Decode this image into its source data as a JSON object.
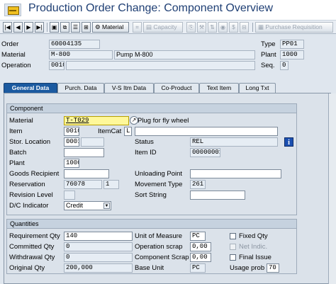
{
  "window": {
    "title": "Production Order Change: Component Overview"
  },
  "toolbar": {
    "material_label": "Material",
    "capacity_label": "Capacity",
    "purchase_requisition_label": "Purchase Requisition"
  },
  "header": {
    "order_label": "Order",
    "order_value": "60004135",
    "type_label": "Type",
    "type_value": "PP01",
    "material_label": "Material",
    "material_value": "M-800",
    "material_desc": "Pump M-800",
    "plant_label": "Plant",
    "plant_value": "1000",
    "operation_label": "Operation",
    "operation_value": "0010",
    "seq_label": "Seq.",
    "seq_value": "0"
  },
  "tabs": [
    "General Data",
    "Purch. Data",
    "V-S Itm Data",
    "Co-Product",
    "Text Item",
    "Long Txt"
  ],
  "component": {
    "heading": "Component",
    "material_label": "Material",
    "material_value": "T-T029",
    "material_desc": "Plug for fly wheel",
    "item_label": "Item",
    "item_value": "0010",
    "itemcat_label": "ItemCat",
    "itemcat_value": "L",
    "stor_location_label": "Stor. Location",
    "stor_location_value": "0001",
    "status_label": "Status",
    "status_value": "REL",
    "batch_label": "Batch",
    "item_id_label": "Item ID",
    "item_id_value": "00000001",
    "plant_label": "Plant",
    "plant_value": "1000",
    "goods_recipient_label": "Goods Recipient",
    "unloading_point_label": "Unloading Point",
    "reservation_label": "Reservation",
    "reservation_value": "76078",
    "reservation_item": "1",
    "movement_type_label": "Movement Type",
    "movement_type_value": "261",
    "revision_level_label": "Revision Level",
    "sort_string_label": "Sort String",
    "dc_indicator_label": "D/C Indicator",
    "dc_indicator_value": "Credit"
  },
  "quantities": {
    "heading": "Quantities",
    "requirement_qty_label": "Requirement Qty",
    "requirement_qty_value": "140",
    "unit_of_measure_label": "Unit of Measure",
    "unit_of_measure_value": "PC",
    "fixed_qty_label": "Fixed Qty",
    "committed_qty_label": "Committed Qty",
    "committed_qty_value": "0",
    "operation_scrap_label": "Operation scrap",
    "operation_scrap_value": "0,00",
    "net_indic_label": "Net Indic.",
    "withdrawal_qty_label": "Withdrawal Qty",
    "withdrawal_qty_value": "0",
    "component_scrap_label": "Component Scrap",
    "component_scrap_value": "0,00",
    "final_issue_label": "Final Issue",
    "original_qty_label": "Original Qty",
    "original_qty_value": "200,000",
    "base_unit_label": "Base Unit",
    "base_unit_value": "PC",
    "usage_prob_label": "Usage prob",
    "usage_prob_value": "70"
  },
  "icons": [
    "first-page-icon",
    "prev-page-icon",
    "next-page-icon",
    "last-page-icon",
    "info-icon",
    "dropdown-icon",
    "match-code-icon"
  ]
}
